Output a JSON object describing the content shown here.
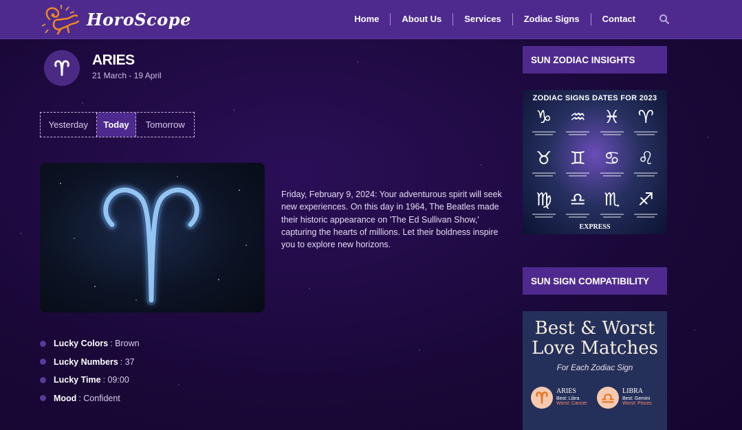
{
  "header": {
    "logo_text": "HoroScope",
    "nav": [
      "Home",
      "About Us",
      "Services",
      "Zodiac Signs",
      "Contact"
    ],
    "search_icon": "search-icon"
  },
  "sign": {
    "name": "ARIES",
    "dates": "21 March - 19 April",
    "icon": "aries-icon"
  },
  "tabs": [
    {
      "label": "Yesterday",
      "active": false
    },
    {
      "label": "Today",
      "active": true
    },
    {
      "label": "Tomorrow",
      "active": false
    }
  ],
  "prediction": "Friday, February 9, 2024: Your adventurous spirit will seek new experiences. On this day in 1964, The Beatles made their historic appearance on 'The Ed Sullivan Show,' capturing the hearts of millions. Let their boldness inspire you to explore new horizons.",
  "traits": [
    {
      "label": "Lucky Colors",
      "value": ": Brown"
    },
    {
      "label": "Lucky Numbers",
      "value": ": 37"
    },
    {
      "label": "Lucky Time",
      "value": ": 09:00"
    },
    {
      "label": "Mood",
      "value": ": Confident"
    }
  ],
  "sidebar": {
    "insights_title": "SUN ZODIAC INSIGHTS",
    "zodiac_card": {
      "title": "ZODIAC SIGNS DATES FOR 2023",
      "glyphs": [
        "♑",
        "♒",
        "♓",
        "♈",
        "♉",
        "♊",
        "♋",
        "♌",
        "♍",
        "♎",
        "♏",
        "♐"
      ],
      "brand": "EXPRESS"
    },
    "compat_title": "SUN SIGN COMPATIBILITY",
    "compat_card": {
      "title_line1": "Best & Worst",
      "title_line2": "Love Matches",
      "subtitle": "For Each Zodiac Sign",
      "pairs": [
        {
          "name": "ARIES",
          "best": "Best: Libra",
          "worst": "Worst: Cancer",
          "glyph": "♈"
        },
        {
          "name": "LIBRA",
          "best": "Best: Gemini",
          "worst": "Worst: Pisces",
          "glyph": "♎"
        }
      ]
    }
  },
  "colors": {
    "header_bg": "#4e2a8e",
    "page_bg": "#1d0a3f",
    "accent": "#4e2a8e",
    "logo_orange": "#f08a1c"
  }
}
